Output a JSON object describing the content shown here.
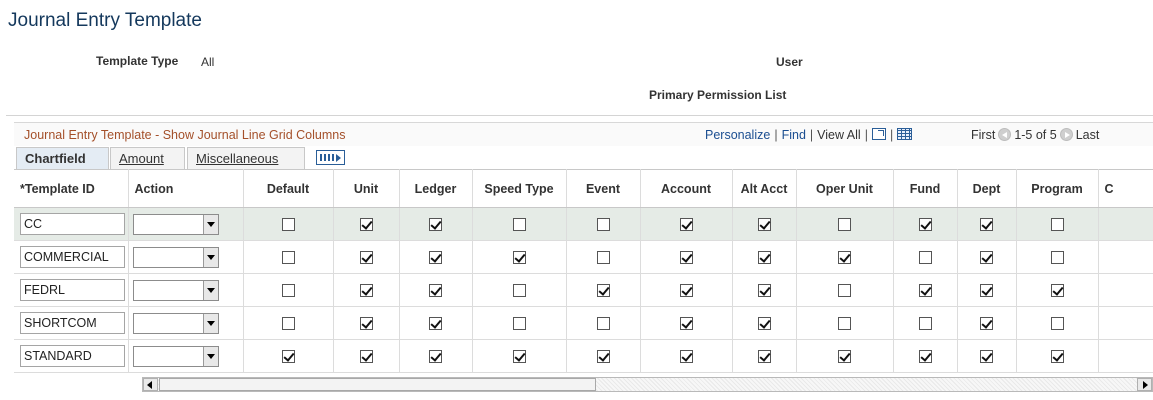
{
  "page": {
    "title": "Journal Entry Template",
    "template_type_label": "Template Type",
    "template_type_value": "All",
    "user_label": "User",
    "primary_permission_label": "Primary Permission List"
  },
  "grid": {
    "title": "Journal Entry Template - Show Journal Line Grid Columns",
    "personalize": "Personalize",
    "find": "Find",
    "view_all": "View All",
    "pager_first": "First",
    "pager_range": "1-5 of 5",
    "pager_last": "Last",
    "tabs": [
      "Chartfield",
      "Amount",
      "Miscellaneous"
    ],
    "columns": [
      "*Template ID",
      "Action",
      "Default",
      "Unit",
      "Ledger",
      "Speed Type",
      "Event",
      "Account",
      "Alt Acct",
      "Oper Unit",
      "Fund",
      "Dept",
      "Program",
      "C"
    ],
    "rows": [
      {
        "id": "CC",
        "checks": [
          false,
          true,
          true,
          false,
          false,
          true,
          true,
          false,
          true,
          true,
          false
        ]
      },
      {
        "id": "COMMERCIAL",
        "checks": [
          false,
          true,
          true,
          true,
          false,
          true,
          true,
          true,
          false,
          true,
          false
        ]
      },
      {
        "id": "FEDRL",
        "checks": [
          false,
          true,
          true,
          false,
          true,
          true,
          true,
          false,
          true,
          true,
          true
        ]
      },
      {
        "id": "SHORTCOM",
        "checks": [
          false,
          true,
          true,
          false,
          false,
          true,
          true,
          false,
          false,
          true,
          false
        ]
      },
      {
        "id": "STANDARD",
        "checks": [
          true,
          true,
          true,
          true,
          true,
          true,
          true,
          true,
          true,
          true,
          true
        ]
      }
    ]
  },
  "icons": {
    "zoom": "new-window-icon",
    "download": "spreadsheet-icon",
    "prev": "previous-arrow-icon",
    "next": "next-arrow-icon",
    "show_all_columns": "show-all-columns-icon"
  }
}
